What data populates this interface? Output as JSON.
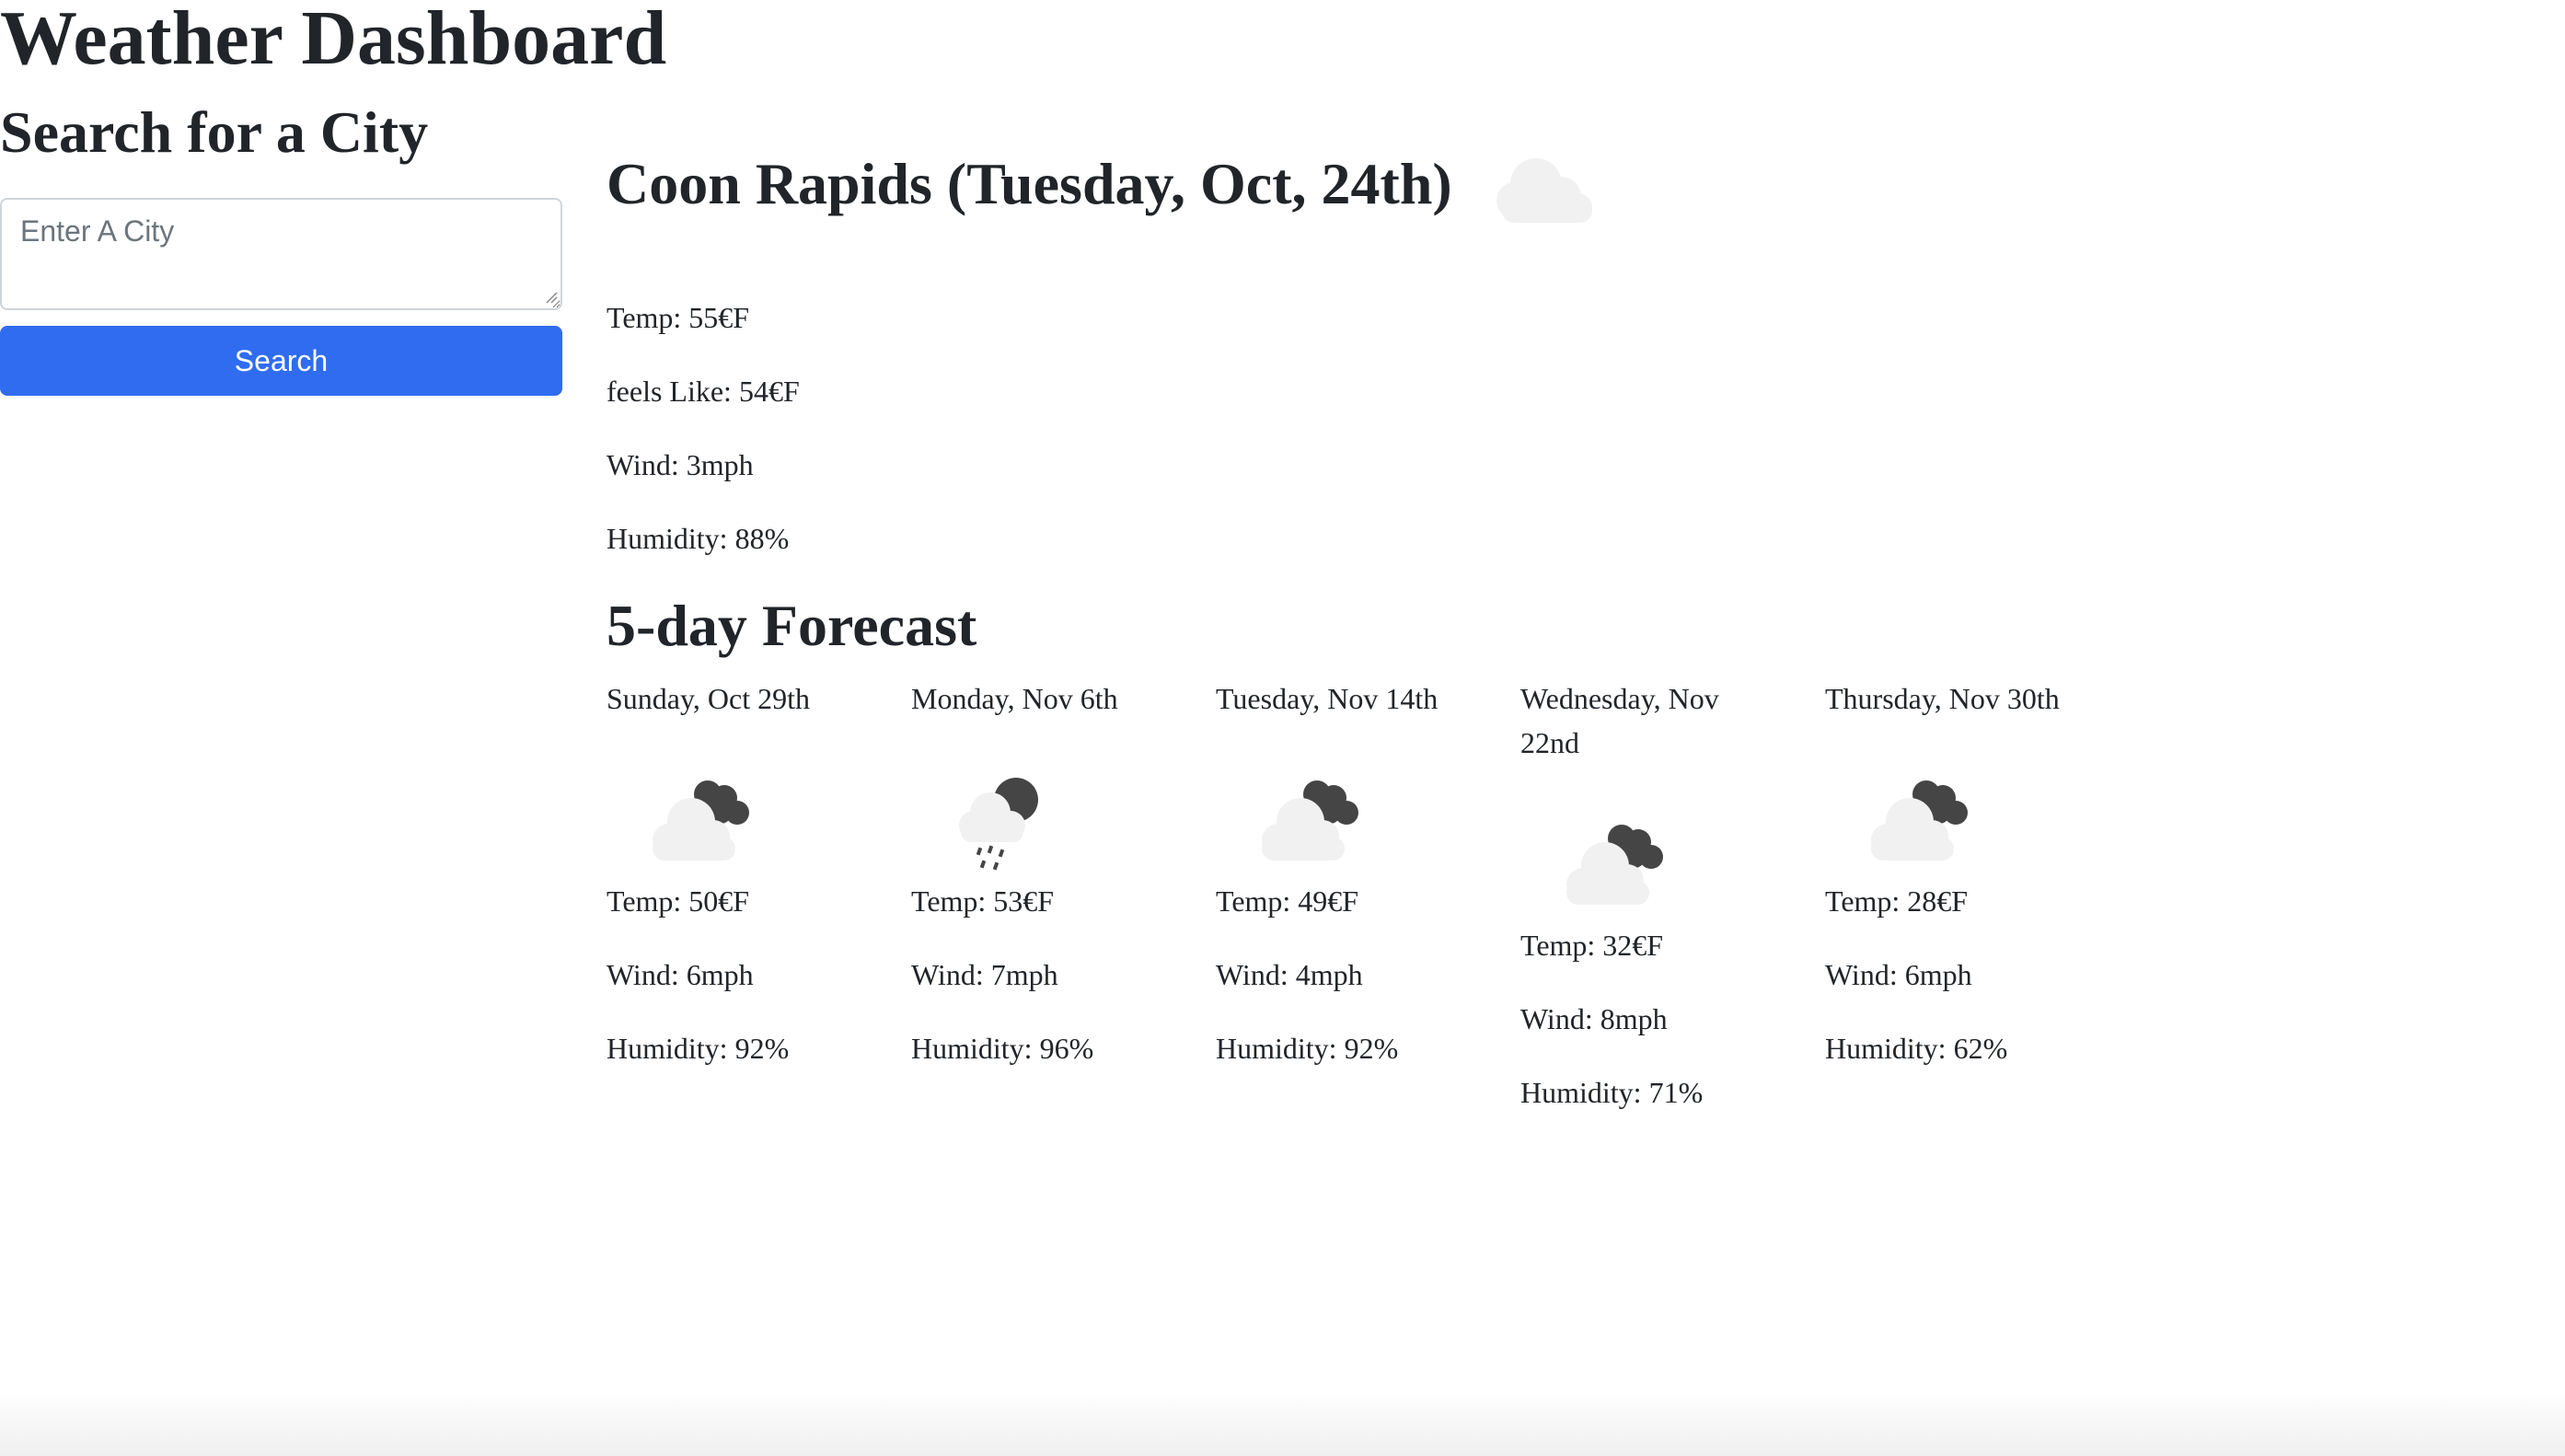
{
  "app_title": "Weather Dashboard",
  "search": {
    "heading": "Search for a City",
    "placeholder": "Enter A City",
    "value": "",
    "button_label": "Search",
    "button_color": "#2f6cf0"
  },
  "current": {
    "title": "Coon Rapids (Tuesday, Oct, 24th)",
    "icon": "cloud-icon",
    "temp": "Temp: 55€F",
    "feels_like": "feels Like: 54€F",
    "wind": "Wind: 3mph",
    "humidity": "Humidity: 88%"
  },
  "forecast": {
    "heading": "5-day Forecast",
    "days": [
      {
        "date": "Sunday, Oct 29th",
        "icon": "cloudy-night-icon",
        "temp": "Temp: 50€F",
        "wind": "Wind: 6mph",
        "humidity": "Humidity: 92%"
      },
      {
        "date": "Monday, Nov 6th",
        "icon": "rain-night-icon",
        "temp": "Temp: 53€F",
        "wind": "Wind: 7mph",
        "humidity": "Humidity: 96%"
      },
      {
        "date": "Tuesday, Nov 14th",
        "icon": "cloudy-night-icon",
        "temp": "Temp: 49€F",
        "wind": "Wind: 4mph",
        "humidity": "Humidity: 92%"
      },
      {
        "date": "Wednesday, Nov 22nd",
        "icon": "cloudy-night-icon",
        "temp": "Temp: 32€F",
        "wind": "Wind: 8mph",
        "humidity": "Humidity: 71%"
      },
      {
        "date": "Thursday, Nov 30th",
        "icon": "cloudy-night-icon",
        "temp": "Temp: 28€F",
        "wind": "Wind: 6mph",
        "humidity": "Humidity: 62%"
      }
    ]
  }
}
